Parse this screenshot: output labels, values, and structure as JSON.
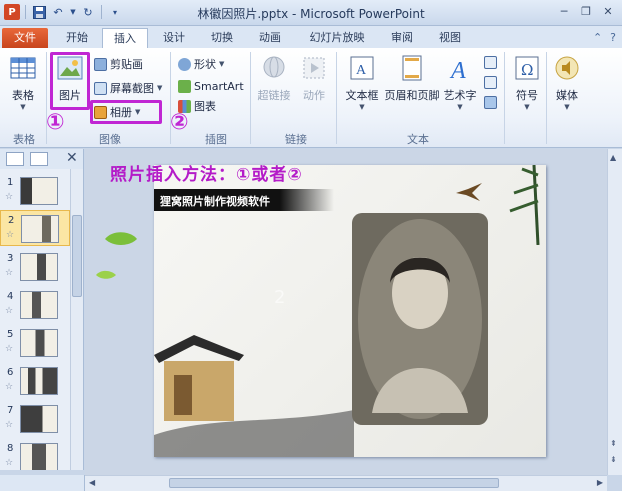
{
  "app": {
    "window_title": "林徽因照片.pptx - Microsoft PowerPoint",
    "app_logo_letter": "P"
  },
  "tabs": [
    {
      "label": "文件",
      "active": false,
      "file": true
    },
    {
      "label": "开始",
      "active": false
    },
    {
      "label": "插入",
      "active": true
    },
    {
      "label": "设计",
      "active": false
    },
    {
      "label": "切换",
      "active": false
    },
    {
      "label": "动画",
      "active": false
    },
    {
      "label": "幻灯片放映",
      "active": false
    },
    {
      "label": "审阅",
      "active": false
    },
    {
      "label": "视图",
      "active": false
    }
  ],
  "ribbon": {
    "groups": {
      "table": "表格",
      "image": "图像",
      "illustration": "插图",
      "link": "链接",
      "text": "文本"
    },
    "buttons": {
      "table": "表格",
      "picture": "图片",
      "clipart": "剪贴画",
      "screenshot": "屏幕截图",
      "album": "相册",
      "shapes": "形状",
      "smartart": "SmartArt",
      "chart": "图表",
      "hyperlink": "超链接",
      "action": "动作",
      "textbox": "文本框",
      "header_footer": "页眉和页脚",
      "wordart": "艺术字",
      "symbol": "符号",
      "media": "媒体"
    }
  },
  "annotations": {
    "circle1": "①",
    "circle2": "②",
    "headline": "照片插入方法：①或者②"
  },
  "slides": [
    {
      "num": "1"
    },
    {
      "num": "2",
      "selected": true
    },
    {
      "num": "3"
    },
    {
      "num": "4"
    },
    {
      "num": "5"
    },
    {
      "num": "6"
    },
    {
      "num": "7"
    },
    {
      "num": "8"
    }
  ],
  "slide_star": "☆",
  "slide": {
    "title": "狸窝照片制作视频软件",
    "ghost_texts": [
      "2"
    ]
  },
  "colors": {
    "highlight": "#c026d3",
    "file_tab": "#d2532a",
    "selected_slide": "#fbe6a4"
  }
}
